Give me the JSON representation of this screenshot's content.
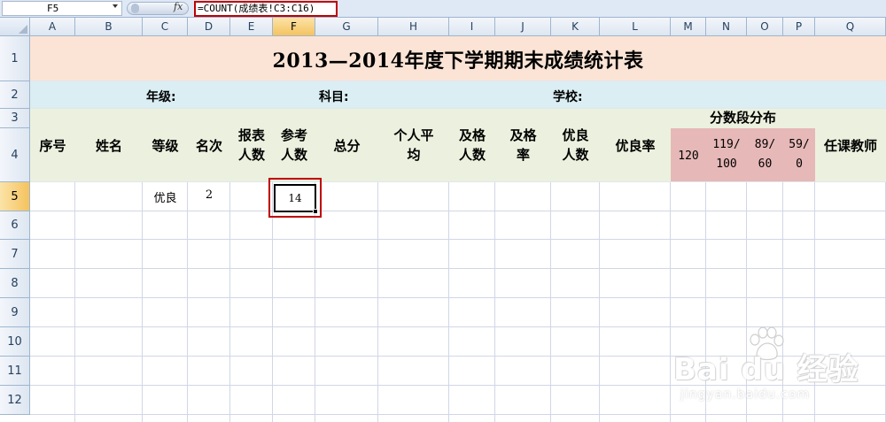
{
  "formula_bar": {
    "name_box": "F5",
    "fx_label": "fx",
    "formula": "=COUNT(成绩表!C3:C16)"
  },
  "columns": [
    "A",
    "B",
    "C",
    "D",
    "E",
    "F",
    "G",
    "H",
    "I",
    "J",
    "K",
    "L",
    "M",
    "N",
    "O",
    "P",
    "Q"
  ],
  "active_column": "F",
  "rows": [
    "1",
    "2",
    "3",
    "4",
    "5",
    "6",
    "7",
    "8",
    "9",
    "10",
    "11",
    "12"
  ],
  "active_row": "5",
  "sheet": {
    "title": "2013—2014年度下学期期末成绩统计表",
    "info": {
      "grade_label": "年级:",
      "subject_label": "科目:",
      "school_label": "学校:"
    },
    "headers": {
      "seq": "序号",
      "name": "姓名",
      "level": "等级",
      "rank": "名次",
      "report_line1": "报表",
      "report_line2": "人数",
      "exam_line1": "参考",
      "exam_line2": "人数",
      "total": "总分",
      "avg_line1": "个人平",
      "avg_line2": "均",
      "pass_line1": "及格",
      "pass_line2": "人数",
      "passrate_line1": "及格",
      "passrate_line2": "率",
      "excellent_line1": "优良",
      "excellent_line2": "人数",
      "excellent_rate": "优良率",
      "score_dist": "分数段分布",
      "teacher": "任课教师"
    },
    "score_ranges": {
      "r1": "120",
      "r2_line1": "119/",
      "r2_line2": "100",
      "r3_line1": "89/",
      "r3_line2": "60",
      "r4_line1": "59/",
      "r4_line2": "0"
    },
    "row5": {
      "level": "优良",
      "rank": "2",
      "exam_count": "14"
    }
  },
  "watermark": {
    "logo": "Bai du 经验",
    "url": "jingyan.baidu.com"
  }
}
